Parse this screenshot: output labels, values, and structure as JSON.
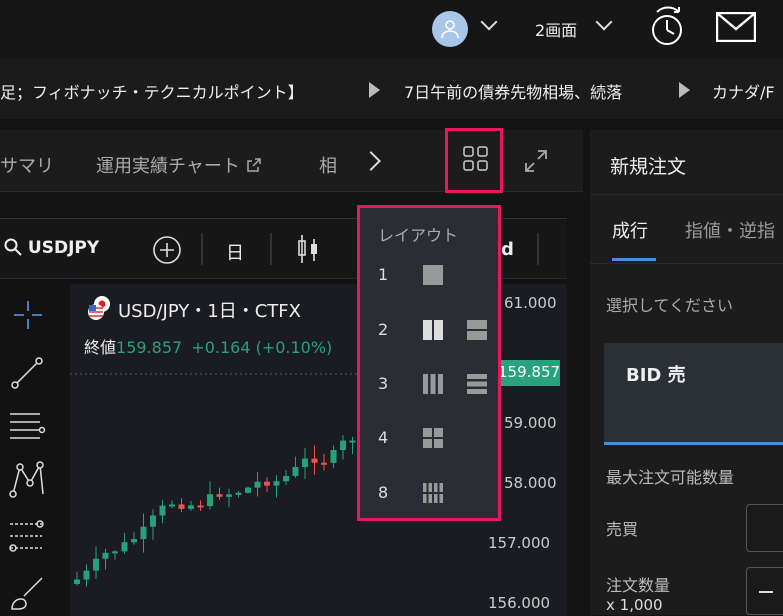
{
  "header": {
    "avatar_icon": "user-icon",
    "screens_label": "2画面",
    "timer_icon": "stopwatch-icon",
    "mail_icon": "mail-icon"
  },
  "ticker": {
    "items": [
      "足；フィボナッチ・テクニカルポイント】",
      "7日午前の債券先物相場、続落",
      "カナダ/F"
    ]
  },
  "tabs": {
    "items": [
      "サマリ",
      "運用実績チャート",
      "相"
    ]
  },
  "chart_toolbar": {
    "symbol": "USDJPY",
    "timeframe": "日",
    "right_fragment": "d"
  },
  "chart": {
    "symbol_line": "USD/JPY・1日・CTFX",
    "close_label": "終値",
    "close_value": "159.857",
    "change": "+0.164 (+0.10%)",
    "current_price": "159.857",
    "price_labels": [
      "61.000",
      "59.000",
      "58.000",
      "157.000",
      "156.000"
    ]
  },
  "layout_menu": {
    "title": "レイアウト",
    "rows": [
      {
        "label": "1",
        "icons": [
          "layout-1-icon"
        ]
      },
      {
        "label": "2",
        "icons": [
          "layout-2-vertical-icon",
          "layout-2-horizontal-icon"
        ]
      },
      {
        "label": "3",
        "icons": [
          "layout-3-vertical-icon",
          "layout-3-horizontal-icon"
        ]
      },
      {
        "label": "4",
        "icons": [
          "layout-4-grid-icon"
        ]
      },
      {
        "label": "8",
        "icons": [
          "layout-8-grid-icon"
        ]
      }
    ]
  },
  "order_panel": {
    "title": "新規注文",
    "tab_market": "成行",
    "tab_limit": "指値・逆指",
    "select_prompt": "選択してください",
    "bid_label": "BID 売",
    "max_qty_label": "最大注文可能数量",
    "buy_sell_label": "売買",
    "qty_label": "注文数量",
    "qty_unit": "x 1,000"
  },
  "colors": {
    "accent_highlight": "#e8185f",
    "up": "#26a17b",
    "down": "#ef5350",
    "tab_underline": "#4a8ed6"
  }
}
